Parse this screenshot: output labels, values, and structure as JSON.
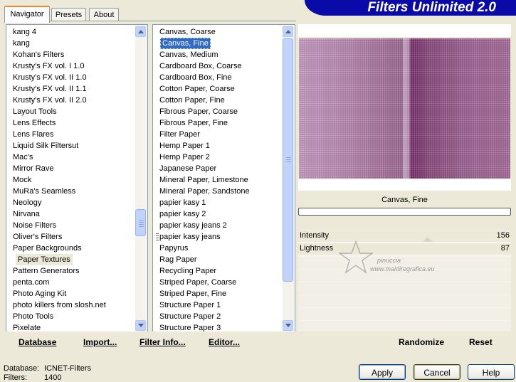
{
  "tabs": [
    "Navigator",
    "Presets",
    "About"
  ],
  "header": {
    "title": "Filters Unlimited 2.0"
  },
  "categories": [
    "kang 4",
    "kang",
    "Kohan's Filters",
    "Krusty's FX vol. I 1.0",
    "Krusty's FX vol. II 1.0",
    "Krusty's FX vol. II 1.1",
    "Krusty's FX vol. II 2.0",
    "Layout Tools",
    "Lens Effects",
    "Lens Flares",
    "Liquid Silk Filtersut",
    "Mac's",
    "Mirror Rave",
    "Mock",
    "MuRa's Seamless",
    "Neology",
    "Nirvana",
    "Noise Filters",
    "Oliver's Filters",
    "Paper Backgrounds",
    "Paper Textures",
    "Pattern Generators",
    "penta.com",
    "Photo Aging Kit",
    "photo killers from slosh.net",
    "Photo Tools",
    "Pixelate"
  ],
  "selected_category_index": 20,
  "filters": [
    "Canvas, Coarse",
    "Canvas, Fine",
    "Canvas, Medium",
    "Cardboard Box, Coarse",
    "Cardboard Box, Fine",
    "Cotton Paper, Coarse",
    "Cotton Paper, Fine",
    "Fibrous Paper, Coarse",
    "Fibrous Paper, Fine",
    "Filter Paper",
    "Hemp Paper 1",
    "Hemp Paper 2",
    "Japanese Paper",
    "Mineral Paper, Limestone",
    "Mineral Paper, Sandstone",
    "papier kasy 1",
    "papier kasy 2",
    "papier kasy jeans 2",
    "papier kasy jeans",
    "Papyrus",
    "Rag Paper",
    "Recycling Paper",
    "Striped Paper, Coarse",
    "Striped Paper, Fine",
    "Structure Paper 1",
    "Structure Paper 2",
    "Structure Paper 3"
  ],
  "selected_filter_index": 1,
  "preview": {
    "filter_name": "Canvas, Fine"
  },
  "params": [
    {
      "label": "Intensity",
      "value": "156"
    },
    {
      "label": "Lightness",
      "value": "87"
    }
  ],
  "watermark": {
    "text1": "pinuccia",
    "text2": "www.maidiregrafica.eu"
  },
  "toolbar": {
    "database": "Database",
    "import": "Import...",
    "filter_info": "Filter Info...",
    "editor": "Editor...",
    "randomize": "Randomize",
    "reset": "Reset"
  },
  "status": {
    "database_label": "Database:",
    "database_value": "ICNET-Filters",
    "filters_label": "Filters:",
    "filters_value": "1400"
  },
  "buttons": {
    "apply": "Apply",
    "cancel": "Cancel",
    "help": "Help"
  },
  "colors": {
    "banner": "#0a0aa8",
    "selection": "#316ac5",
    "preview_accent": "#8b4c7e"
  }
}
